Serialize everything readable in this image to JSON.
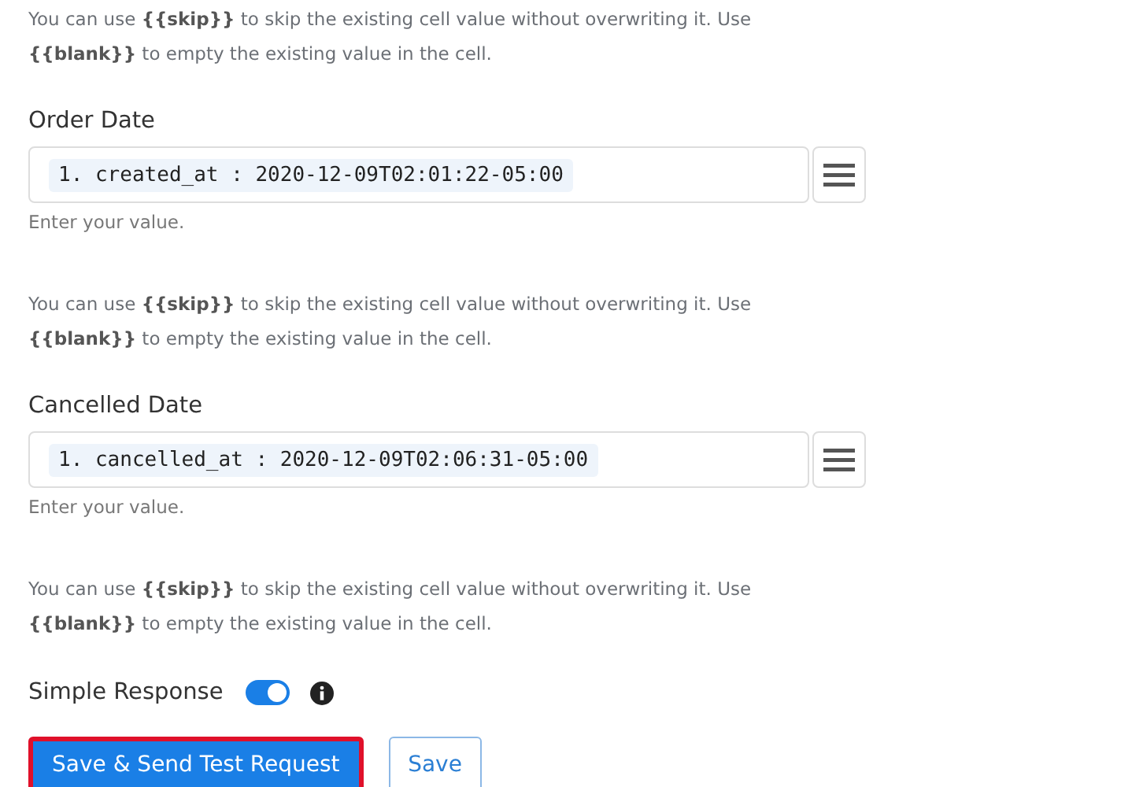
{
  "intro_help": "You can use **{{skip}}** to skip the existing cell value without overwriting it. Use **{{blank}}** to empty the existing value in the cell.",
  "fields": [
    {
      "label": "Order Date",
      "token": "1. created_at : 2020-12-09T02:01:22-05:00",
      "hint": "Enter your value.",
      "help": "You can use **{{skip}}** to skip the existing cell value without overwriting it. Use **{{blank}}** to empty the existing value in the cell."
    },
    {
      "label": "Cancelled Date",
      "token": "1. cancelled_at : 2020-12-09T02:06:31-05:00",
      "hint": "Enter your value.",
      "help": "You can use **{{skip}}** to skip the existing cell value without overwriting it. Use **{{blank}}** to empty the existing value in the cell."
    }
  ],
  "simple_response": {
    "label": "Simple Response",
    "on": true
  },
  "buttons": [
    {
      "label": "Save & Send Test Request",
      "kind": "primary",
      "highlighted": true
    },
    {
      "label": "Save",
      "kind": "outline",
      "highlighted": false
    }
  ]
}
